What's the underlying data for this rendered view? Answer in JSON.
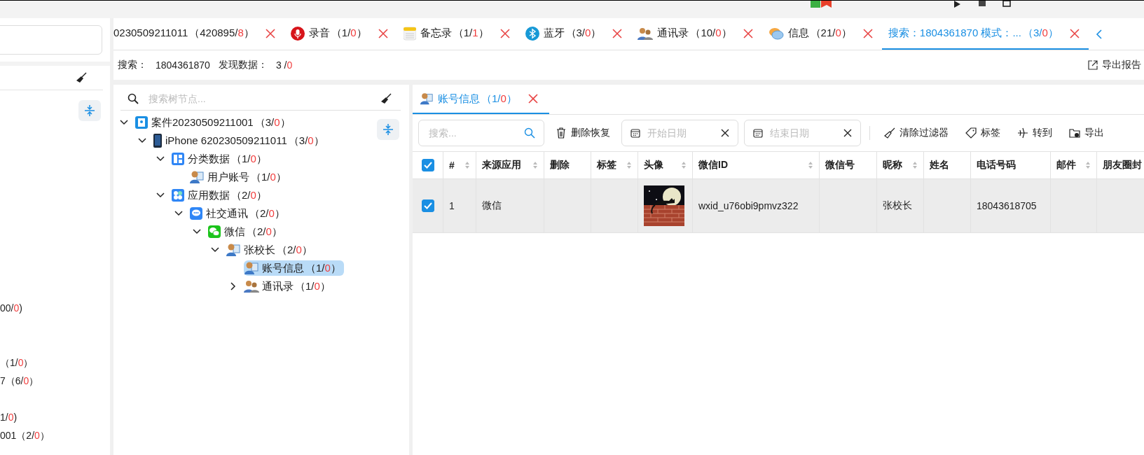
{
  "tabs": [
    {
      "kind": "plain",
      "label": "0230509211011",
      "count": "（420895/",
      "flagged": "8",
      "close": "）",
      "selected": false
    },
    {
      "kind": "mic",
      "label": "录音",
      "count": "（1/",
      "flagged": "0",
      "close": "）",
      "selected": false
    },
    {
      "kind": "notes",
      "label": "备忘录",
      "count": "（1/",
      "flagged": "1",
      "close": "）",
      "selected": false
    },
    {
      "kind": "bluetooth",
      "label": "蓝牙",
      "count": "（3/",
      "flagged": "0",
      "close": "）",
      "selected": false
    },
    {
      "kind": "contacts",
      "label": "通讯录",
      "count": "（10/",
      "flagged": "0",
      "close": "）",
      "selected": false
    },
    {
      "kind": "messages",
      "label": "信息",
      "count": "（21/",
      "flagged": "0",
      "close": "）",
      "selected": false
    },
    {
      "kind": "plain",
      "label": "搜索：1804361870  模式：...",
      "count": "（3/",
      "flagged": "0",
      "close": "）",
      "selected": true
    }
  ],
  "info_bar": {
    "search_label": "搜索：",
    "search_value": "1804361870",
    "found_label": "发现数据：",
    "found_count": "3 /",
    "found_flagged": "0",
    "export": "导出报告"
  },
  "left_panel": {
    "items": [
      {
        "lead": "00/",
        "flagged": "0",
        "close": ")"
      },
      {
        "lead": "（1/",
        "flagged": "0",
        "close": "）"
      },
      {
        "lead": "7（6/",
        "flagged": "0",
        "close": "）"
      },
      {
        "lead": "1/",
        "flagged": "0",
        "close": ")"
      },
      {
        "lead": "001（2/",
        "flagged": "0",
        "close": "）"
      }
    ]
  },
  "tree": {
    "placeholder": "搜索树节点...",
    "nodes": [
      {
        "kind": "case",
        "label": "案件20230509211001",
        "count": "（3/",
        "flagged": "0",
        "close": "）",
        "expanded": true,
        "selected": false,
        "children": [
          {
            "kind": "phone",
            "label": "iPhone 620230509211011",
            "count": "（3/",
            "flagged": "0",
            "close": "）",
            "expanded": true,
            "selected": false,
            "children": [
              {
                "kind": "grid",
                "label": "分类数据",
                "count": "（1/",
                "flagged": "0",
                "close": "）",
                "expanded": true,
                "selected": false,
                "children": [
                  {
                    "kind": "user",
                    "label": "用户账号",
                    "count": "（1/",
                    "flagged": "0",
                    "close": "）",
                    "selected": false
                  }
                ]
              },
              {
                "kind": "apps",
                "label": "应用数据",
                "count": "（2/",
                "flagged": "0",
                "close": "）",
                "expanded": true,
                "selected": false,
                "children": [
                  {
                    "kind": "chat",
                    "label": "社交通讯",
                    "count": "（2/",
                    "flagged": "0",
                    "close": "）",
                    "expanded": true,
                    "selected": false,
                    "children": [
                      {
                        "kind": "wechat",
                        "label": "微信",
                        "count": "（2/",
                        "flagged": "0",
                        "close": "）",
                        "expanded": true,
                        "selected": false,
                        "children": [
                          {
                            "kind": "user",
                            "label": "张校长",
                            "count": "（2/",
                            "flagged": "0",
                            "close": "）",
                            "expanded": true,
                            "selected": false,
                            "children": [
                              {
                                "kind": "user",
                                "label": "账号信息",
                                "count": "（1/",
                                "flagged": "0",
                                "close": "）",
                                "selected": true
                              },
                              {
                                "kind": "contacts",
                                "label": "通讯录",
                                "count": "（1/",
                                "flagged": "0",
                                "close": "）",
                                "expanded": false,
                                "selected": false
                              }
                            ]
                          }
                        ]
                      }
                    ]
                  }
                ]
              }
            ]
          }
        ]
      }
    ]
  },
  "content_tab": {
    "label": "账号信息",
    "count": "（1/",
    "flagged": "0",
    "close": "）",
    "selected": true
  },
  "toolbar": {
    "search_placeholder": "搜索...",
    "restore": "删除恢复",
    "start_date_placeholder": "开始日期",
    "end_date_placeholder": "结束日期",
    "actions": [
      {
        "kind": "clear",
        "label": "清除过滤器"
      },
      {
        "kind": "tag",
        "label": "标签"
      },
      {
        "kind": "goto",
        "label": "转到"
      },
      {
        "kind": "export",
        "label": "导出"
      }
    ]
  },
  "table": {
    "all_checked": true,
    "columns": [
      {
        "label": "#",
        "sortable": true
      },
      {
        "label": "来源应用",
        "sortable": true
      },
      {
        "label": "删除",
        "sortable": false
      },
      {
        "label": "标签",
        "sortable": true
      },
      {
        "label": "头像",
        "sortable": true
      },
      {
        "label": "微信ID",
        "sortable": true
      },
      {
        "label": "微信号",
        "sortable": false
      },
      {
        "label": "昵称",
        "sortable": true
      },
      {
        "label": "姓名",
        "sortable": false
      },
      {
        "label": "电话号码",
        "sortable": false
      },
      {
        "label": "邮件",
        "sortable": true
      },
      {
        "label": "朋友圈封"
      }
    ],
    "rows": [
      {
        "checked": true,
        "selected": true,
        "cells": [
          {
            "kind": "text",
            "text": "1"
          },
          {
            "kind": "text",
            "text": "微信"
          },
          {
            "kind": "empty"
          },
          {
            "kind": "empty"
          },
          {
            "kind": "picture"
          },
          {
            "kind": "text",
            "text": "wxid_u76obi9pmvz322"
          },
          {
            "kind": "empty"
          },
          {
            "kind": "text",
            "text": "张校长"
          },
          {
            "kind": "empty"
          },
          {
            "kind": "text",
            "text": "18043618705"
          },
          {
            "kind": "empty"
          },
          {
            "kind": "empty"
          }
        ]
      }
    ]
  }
}
